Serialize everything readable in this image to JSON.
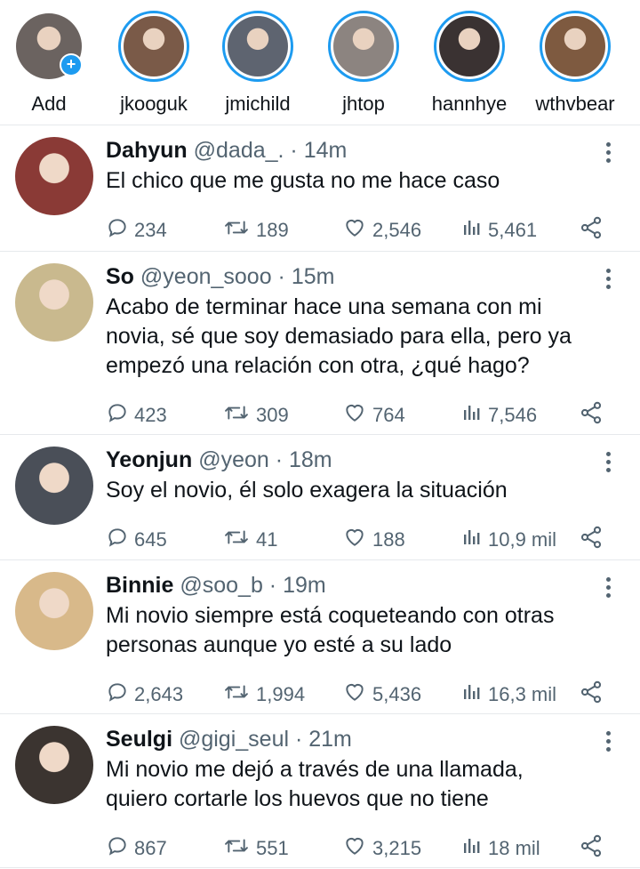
{
  "stories": [
    {
      "label": "Add",
      "ring": false,
      "plus": "+",
      "color": "#6b6360"
    },
    {
      "label": "jkooguk",
      "ring": true,
      "color": "#7a5a48"
    },
    {
      "label": "jmichild",
      "ring": true,
      "color": "#5e6470"
    },
    {
      "label": "jhtop",
      "ring": true,
      "color": "#8c8480"
    },
    {
      "label": "hannhye",
      "ring": true,
      "color": "#3a3232"
    },
    {
      "label": "wthvbear",
      "ring": true,
      "color": "#7e5a40"
    }
  ],
  "tweets": [
    {
      "name": "Dahyun",
      "meta": "@dada_. · 14m",
      "lines": [
        "El chico que me gusta no me hace caso"
      ],
      "replies": "234",
      "retweets": "189",
      "likes": "2,546",
      "views": "5,461",
      "avatar_color": "#8a3a36"
    },
    {
      "name": "So",
      "meta": "@yeon_sooo · 15m",
      "lines": [
        "Acabo de terminar hace una semana con mi",
        "novia, sé que soy demasiado para ella, pero ya",
        "empezó una relación con otra, ¿qué hago?"
      ],
      "replies": "423",
      "retweets": "309",
      "likes": "764",
      "views": "7,546",
      "avatar_color": "#c9b98e"
    },
    {
      "name": "Yeonjun",
      "meta": "@yeon · 18m",
      "lines": [
        "Soy el novio, él solo exagera la situación"
      ],
      "replies": "645",
      "retweets": "41",
      "likes": "188",
      "views": "10,9 mil",
      "avatar_color": "#4a4f58"
    },
    {
      "name": "Binnie",
      "meta": "@soo_b · 19m",
      "lines": [
        "Mi novio siempre está coqueteando con otras",
        "personas aunque yo esté a su lado"
      ],
      "replies": "2,643",
      "retweets": "1,994",
      "likes": "5,436",
      "views": "16,3 mil",
      "avatar_color": "#d8b98a"
    },
    {
      "name": "Seulgi",
      "meta": "@gigi_seul · 21m",
      "lines": [
        "Mi novio me dejó a través de una llamada,",
        "quiero cortarle los huevos que no tiene"
      ],
      "replies": "867",
      "retweets": "551",
      "likes": "3,215",
      "views": "18 mil",
      "avatar_color": "#3b3430"
    }
  ],
  "colors": {
    "accent": "#1d9bf0",
    "text": "#0f1419",
    "muted": "#536471",
    "divider": "#e6e9ec"
  },
  "icons": [
    "reply-icon",
    "retweet-icon",
    "like-icon",
    "views-icon",
    "share-icon",
    "more-icon"
  ]
}
